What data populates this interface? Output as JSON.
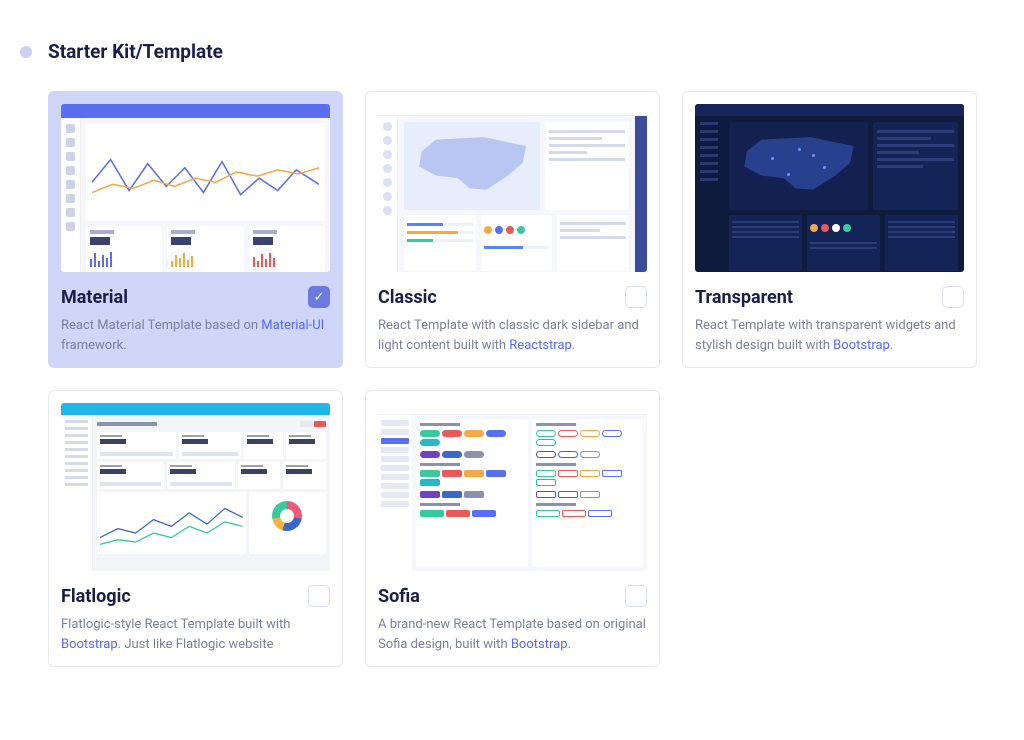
{
  "section_title": "Starter Kit/Template",
  "templates": [
    {
      "name": "Material",
      "description_pre": "React Material Template based on ",
      "link_text": "Material-UI",
      "description_post": " framework.",
      "selected": true
    },
    {
      "name": "Classic",
      "description_pre": "React Template with classic dark sidebar and light content built with ",
      "link_text": "Reactstrap",
      "description_post": ".",
      "selected": false
    },
    {
      "name": "Transparent",
      "description_pre": "React Template with transparent widgets and stylish design built with ",
      "link_text": "Bootstrap",
      "description_post": ".",
      "selected": false
    },
    {
      "name": "Flatlogic",
      "description_pre": "Flatlogic-style React Template built with ",
      "link_text": "Bootstrap",
      "description_post": ". Just like Flatlogic website",
      "selected": false
    },
    {
      "name": "Sofia",
      "description_pre": "A brand-new React Template based on original Sofia design, built with ",
      "link_text": "Bootstrap",
      "description_post": ".",
      "selected": false
    }
  ]
}
